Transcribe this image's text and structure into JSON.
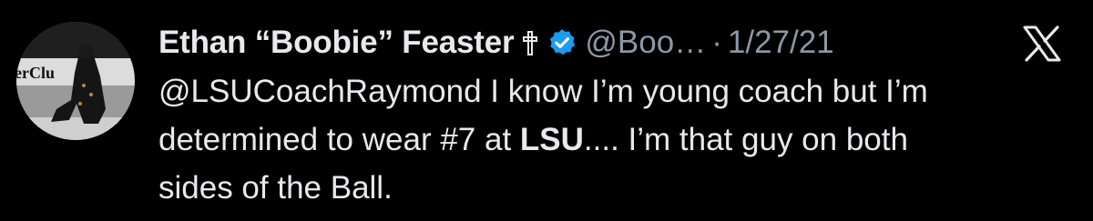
{
  "tweet": {
    "display_name": "Ethan “Boobie” Feaster",
    "handle": "@Boo…",
    "separator": "·",
    "date": "1/27/21",
    "avatar_text": "erClu",
    "icons": {
      "name_badge": "latin-cross-icon",
      "verified": "verified-badge-icon",
      "platform": "x-logo-icon"
    },
    "colors": {
      "background": "#000000",
      "text": "#e7e9ea",
      "secondary_text": "#8b98a5",
      "verified_blue": "#1d9bf0"
    },
    "body": {
      "line1": "@LSUCoachRaymond I know I’m young coach but I’m",
      "line2_pre": "determined to wear #7 at ",
      "line2_bold": "LSU",
      "line2_post": ".... I’m that guy on both",
      "line3": "sides of the Ball."
    }
  }
}
